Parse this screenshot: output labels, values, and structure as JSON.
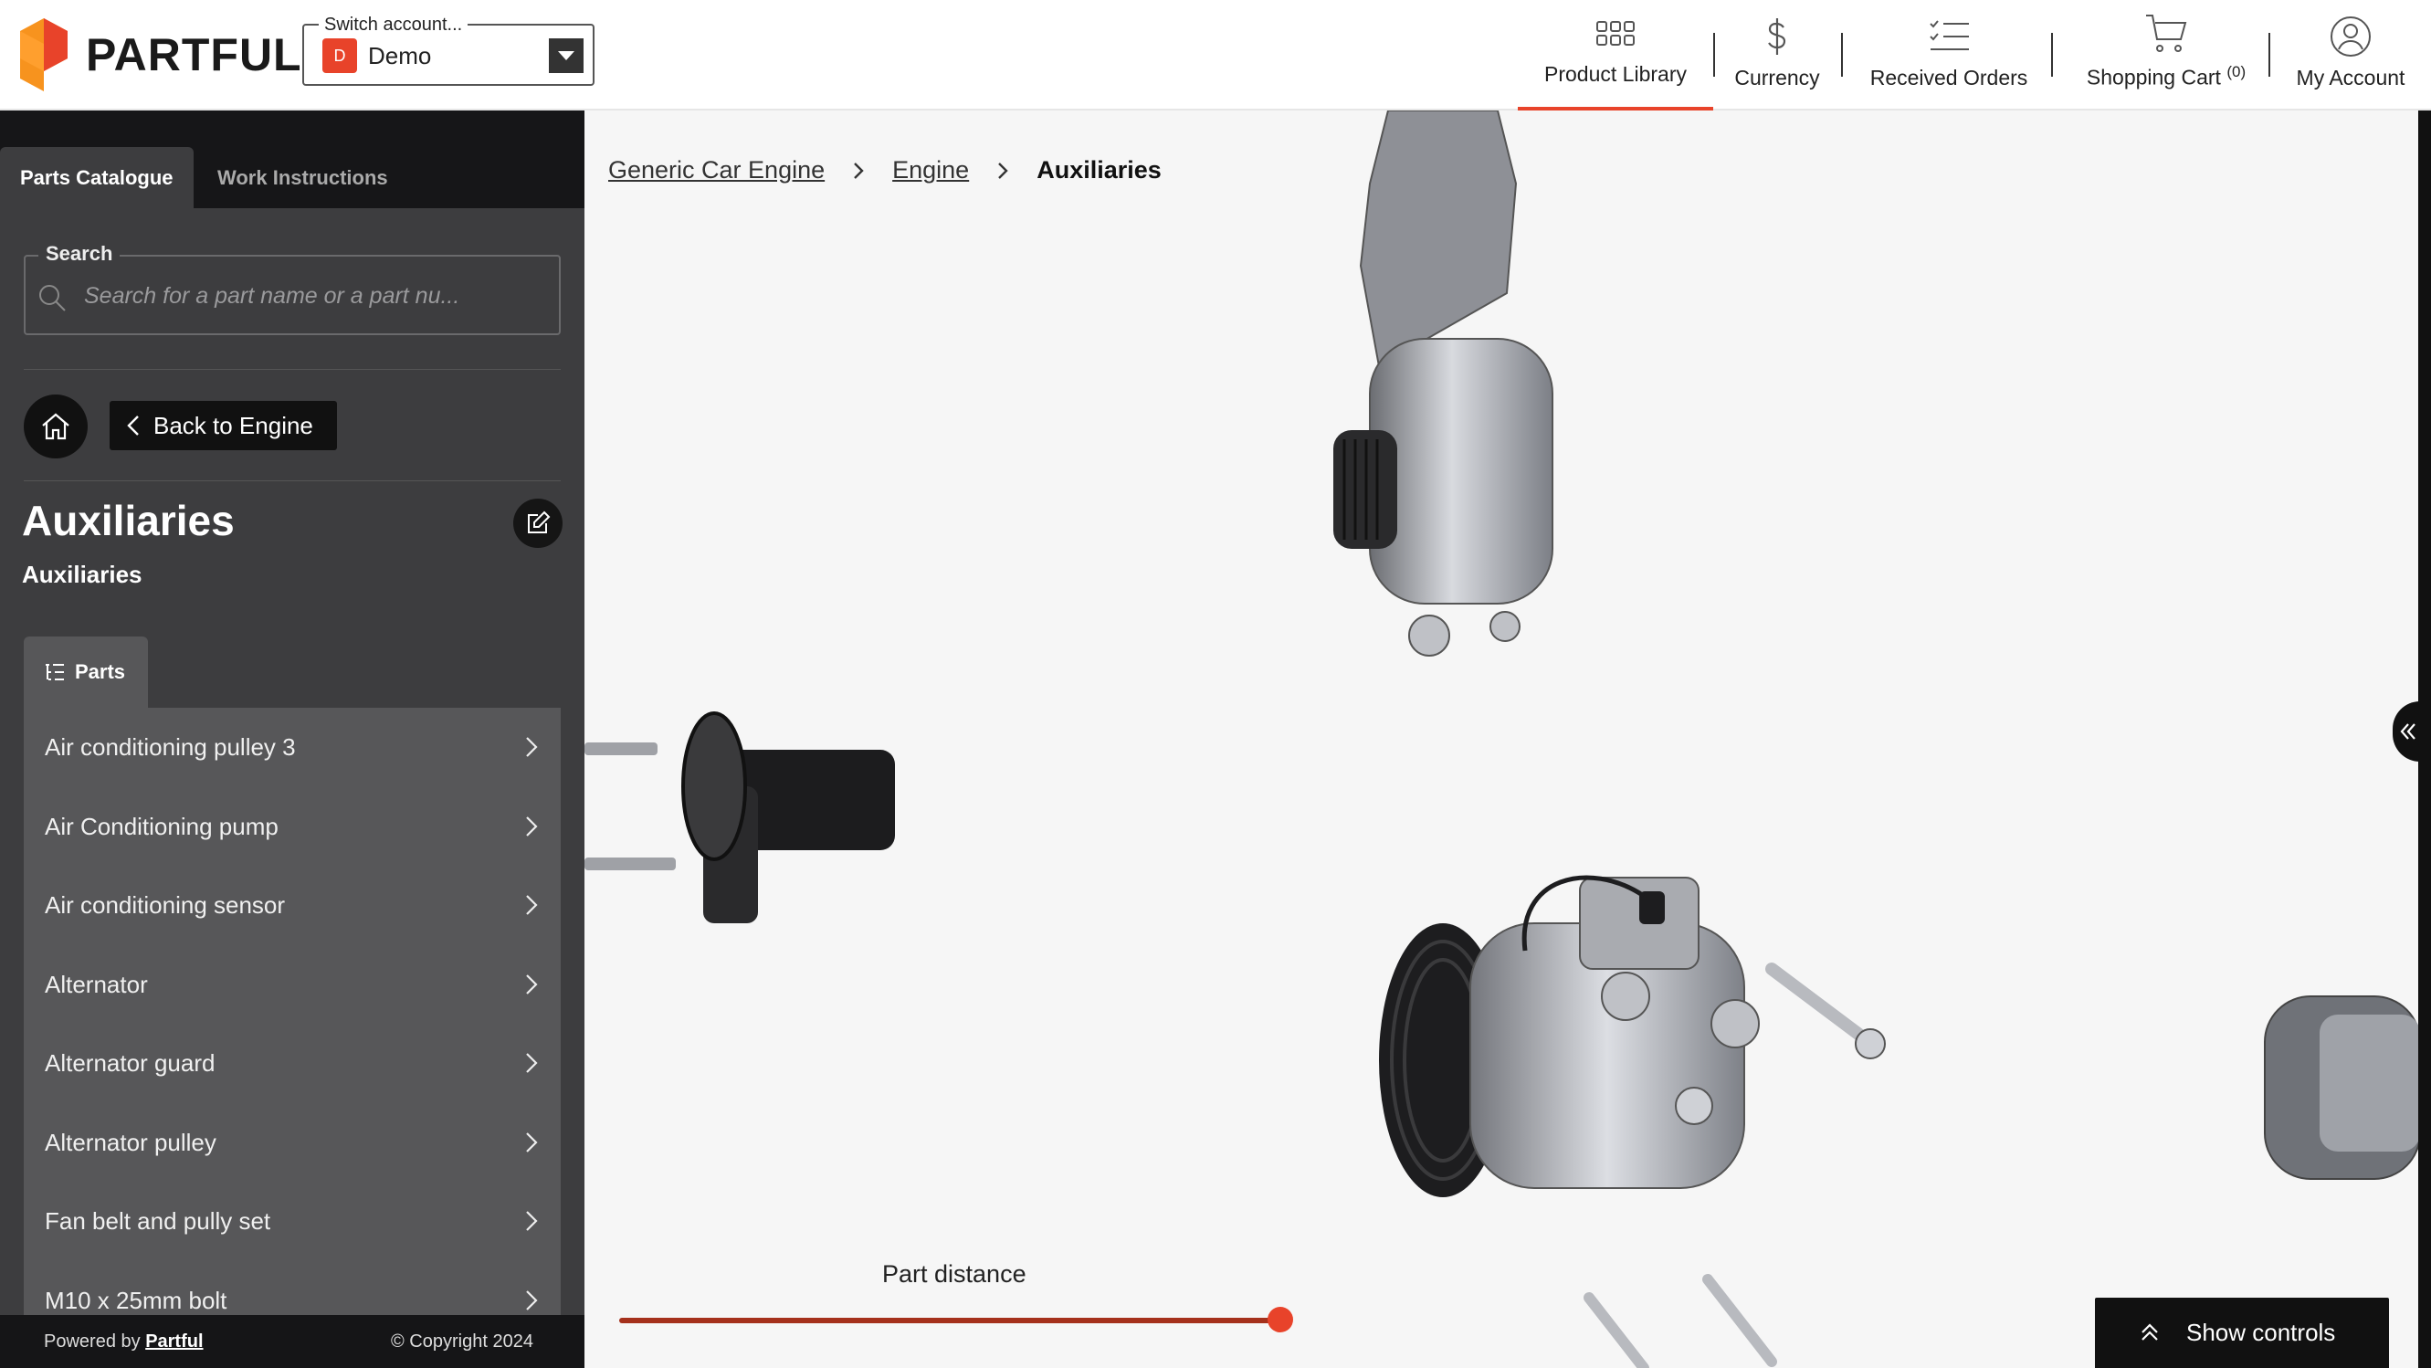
{
  "brand": {
    "name": "PARTFUL",
    "accent": "#e8432a"
  },
  "account": {
    "legend": "Switch account...",
    "badge": "D",
    "name": "Demo"
  },
  "nav": {
    "items": [
      {
        "label": "Product Library",
        "icon": "grid-icon",
        "active": true
      },
      {
        "label": "Currency",
        "icon": "dollar-icon"
      },
      {
        "label": "Received Orders",
        "icon": "checklist-icon"
      },
      {
        "label": "Shopping Cart",
        "icon": "cart-icon",
        "badge": "(0)"
      },
      {
        "label": "My Account",
        "icon": "user-icon"
      }
    ]
  },
  "sidebar": {
    "tabs": [
      "Parts Catalogue",
      "Work Instructions"
    ],
    "search": {
      "label": "Search",
      "placeholder": "Search for a part name or a part nu..."
    },
    "back_label": "Back to Engine",
    "title": "Auxiliaries",
    "subtitle": "Auxiliaries",
    "parts_tab": "Parts",
    "parts": [
      "Air conditioning pulley 3",
      "Air Conditioning pump",
      "Air conditioning sensor",
      "Alternator",
      "Alternator guard",
      "Alternator pulley",
      "Fan belt and pully set",
      "M10 x 25mm bolt"
    ],
    "footer": {
      "powered_by": "Powered by",
      "powered_link": "Partful",
      "copyright": "© Copyright 2024"
    }
  },
  "viewer": {
    "breadcrumb": [
      "Generic Car Engine",
      "Engine",
      "Auxiliaries"
    ],
    "slider": {
      "label": "Part distance",
      "value": 1.0
    },
    "show_controls": "Show controls"
  }
}
